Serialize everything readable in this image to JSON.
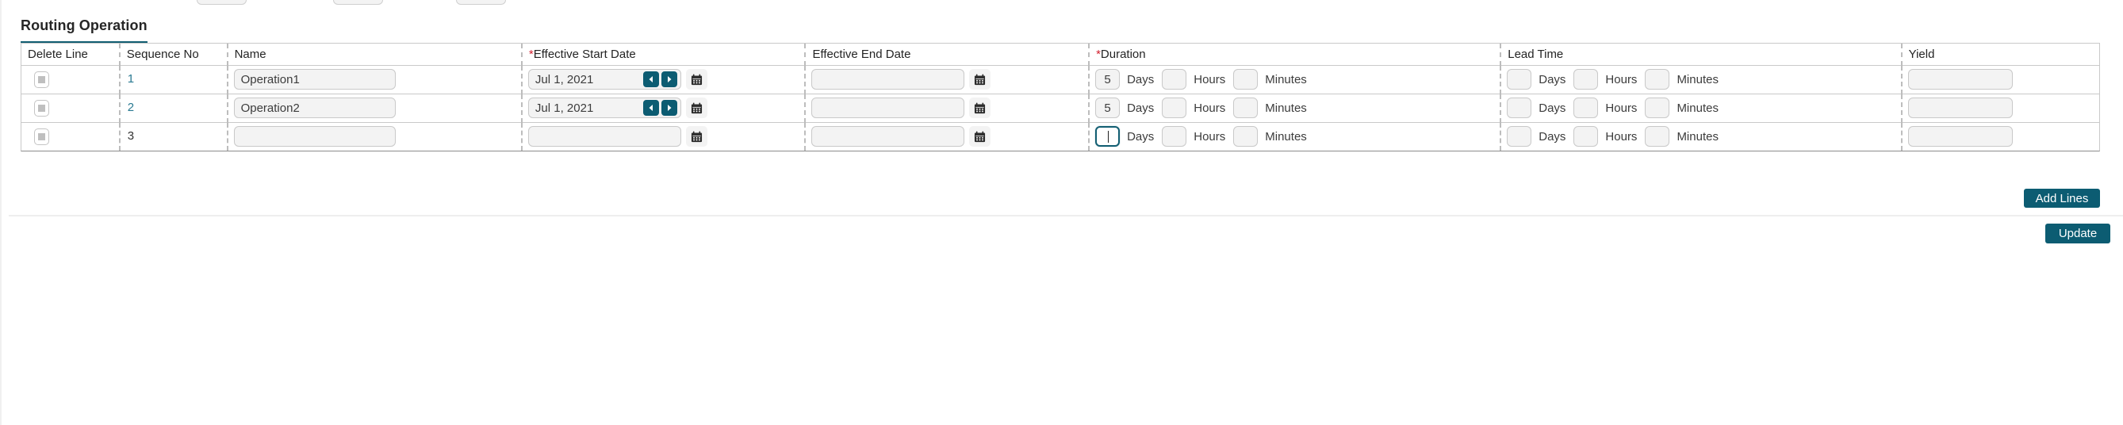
{
  "section": {
    "tab_label": "Routing Operation"
  },
  "grid": {
    "columns": [
      {
        "label": "Delete Line",
        "required": false
      },
      {
        "label": "Sequence No",
        "required": false
      },
      {
        "label": "Name",
        "required": false
      },
      {
        "label": "Effective Start Date",
        "required": true
      },
      {
        "label": "Effective End Date",
        "required": false
      },
      {
        "label": "Duration",
        "required": true
      },
      {
        "label": "Lead Time",
        "required": false
      },
      {
        "label": "Yield",
        "required": false
      }
    ],
    "units": {
      "days": "Days",
      "hours": "Hours",
      "minutes": "Minutes"
    },
    "rows": [
      {
        "sequence_no": "1",
        "sequence_is_link": true,
        "name": "Operation1",
        "effective_start_date": "Jul 1, 2021",
        "has_date_stepper": true,
        "effective_end_date": "",
        "duration": {
          "days": "5",
          "hours": "",
          "minutes": ""
        },
        "lead_time": {
          "days": "",
          "hours": "",
          "minutes": ""
        },
        "yield": "",
        "focused_field": ""
      },
      {
        "sequence_no": "2",
        "sequence_is_link": true,
        "name": "Operation2",
        "effective_start_date": "Jul 1, 2021",
        "has_date_stepper": true,
        "effective_end_date": "",
        "duration": {
          "days": "5",
          "hours": "",
          "minutes": ""
        },
        "lead_time": {
          "days": "",
          "hours": "",
          "minutes": ""
        },
        "yield": "",
        "focused_field": ""
      },
      {
        "sequence_no": "3",
        "sequence_is_link": false,
        "name": "",
        "effective_start_date": "",
        "has_date_stepper": false,
        "effective_end_date": "",
        "duration": {
          "days": "",
          "hours": "",
          "minutes": ""
        },
        "lead_time": {
          "days": "",
          "hours": "",
          "minutes": ""
        },
        "yield": "",
        "focused_field": "duration_days"
      }
    ]
  },
  "actions": {
    "add_lines_label": "Add Lines",
    "update_label": "Update"
  },
  "icons": {
    "calendar": "calendar-icon",
    "prev": "chevron-left-icon",
    "next": "chevron-right-icon",
    "checkbox": "checkbox-icon"
  },
  "colors": {
    "accent": "#0c5c72",
    "tab_underline": "#125e72",
    "link": "#2a7a92",
    "required_star": "#d2202f",
    "field_bg": "#f3f3f3",
    "field_border": "#c9c9c9"
  }
}
